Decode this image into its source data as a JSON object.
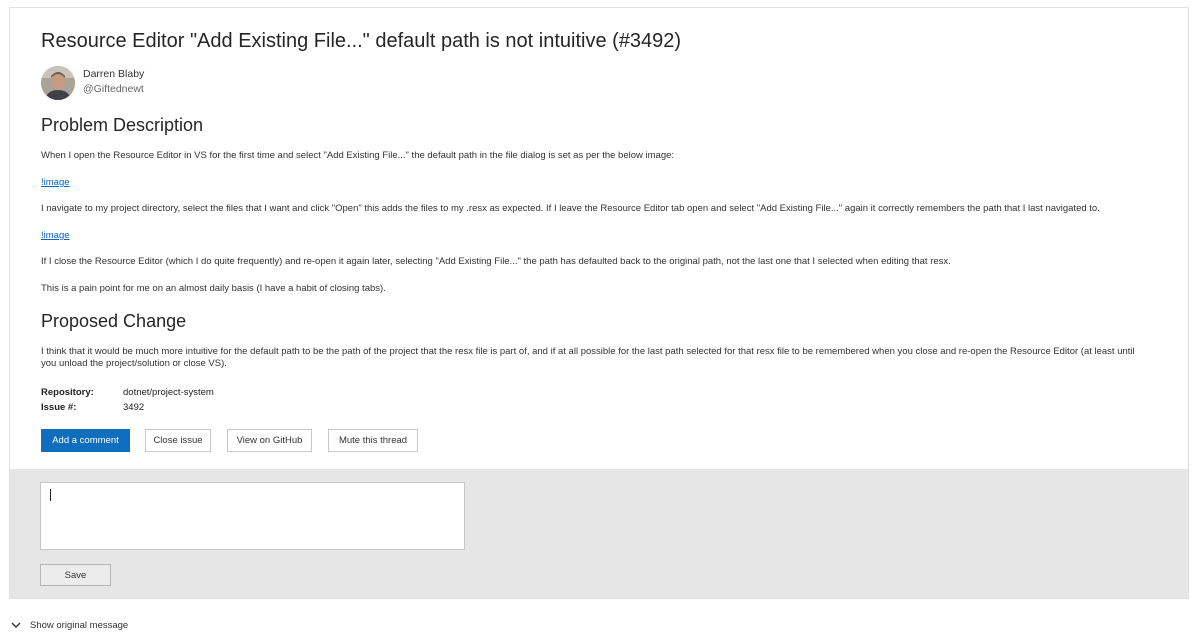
{
  "issue": {
    "title": "Resource Editor \"Add Existing File...\" default path is not intuitive (#3492)",
    "author_name": "Darren Blaby",
    "author_handle": "@Giftednewt"
  },
  "sections": {
    "problem": {
      "heading": "Problem Description",
      "p1": "When I open the Resource Editor in VS for the first time and select \"Add Existing File...\" the default path in the file dialog is set as per the below image:",
      "link1": "!image",
      "p2": "I navigate to my project directory, select the files that I want and click \"Open\" this adds the files to my .resx as expected. If I leave the Resource Editor tab open and select \"Add Existing File...\" again it correctly remembers the path that I last navigated to.",
      "link2": "!image",
      "p3": "If I close the Resource Editor (which I do quite frequently) and re-open it again later, selecting \"Add Existing File...\" the path has defaulted back to the original path, not the last one that I selected when editing that resx.",
      "p4": "This is a pain point for me on an almost daily basis (I have a habit of closing tabs)."
    },
    "proposed": {
      "heading": "Proposed Change",
      "p1": "I think that it would be much more intuitive for the default path to be the path of the project that the resx file is part of, and if at all possible for the last path selected for that resx file to be remembered when you close and re-open the Resource Editor (at least until you unload the project/solution or close VS)."
    }
  },
  "meta": {
    "repository_label": "Repository:",
    "repository_value": "dotnet/project-system",
    "issue_label": "Issue #:",
    "issue_value": "3492"
  },
  "actions": {
    "add_comment": "Add a comment",
    "close_issue": "Close issue",
    "view_github": "View on GitHub",
    "mute_thread": "Mute this thread"
  },
  "compose": {
    "textarea_value": "",
    "save_label": "Save"
  },
  "footer": {
    "show_original": "Show original message"
  },
  "icons": {
    "chevron": "chevron-down-icon",
    "avatar": "avatar"
  },
  "colors": {
    "primary": "#106ebe",
    "link": "#0563c1",
    "compose_bg": "#e6e6e6"
  }
}
